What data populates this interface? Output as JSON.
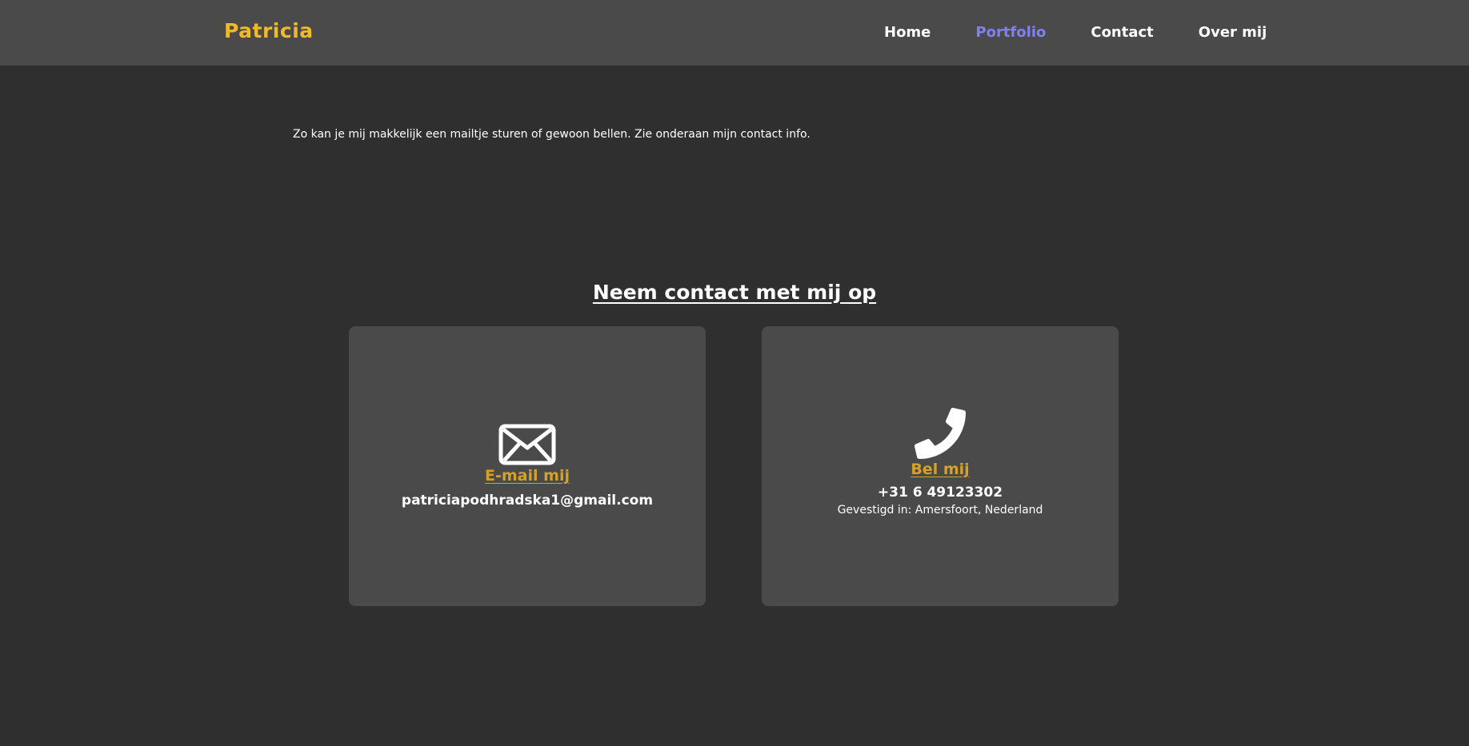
{
  "nav": {
    "brand": "Patricia",
    "links": [
      "Home",
      "Portfolio",
      "Contact",
      "Over mij"
    ],
    "active_link": "Portfolio"
  },
  "intro": {
    "text": "Zo kan je mij makkelijk een mailtje sturen of gewoon bellen. Zie onderaan mijn contact info."
  },
  "contact": {
    "title": "Neem contact met mij op",
    "email_card": {
      "icon": "envelope-icon",
      "heading": "E-mail mij",
      "value": "patriciapodhradska1@gmail.com"
    },
    "phone_card": {
      "icon": "phone-icon",
      "heading": "Bel mij",
      "value": "+31 6 49123302",
      "location": "Gevestigd in: Amersfoort, Nederland"
    }
  },
  "colors": {
    "page_background": "#2f2f2f",
    "navbar_background": "#4a4a4a",
    "card_background": "#4a4a4a",
    "brand": "#f0b92a",
    "active_link": "#8080f0",
    "card_heading": "#d8a126",
    "text": "#ffffff"
  }
}
